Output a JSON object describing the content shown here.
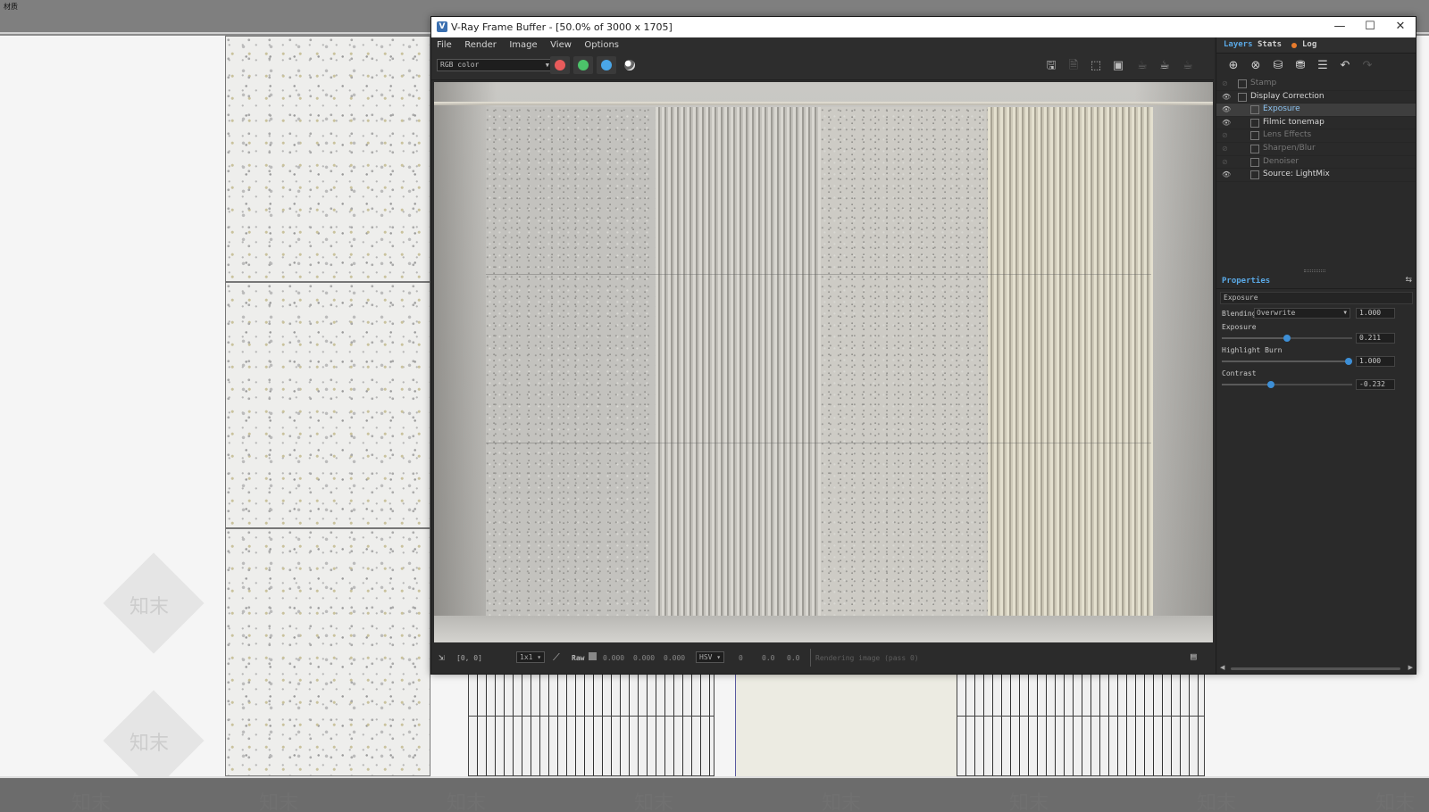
{
  "workspace": {
    "corner_text": "材质",
    "watermark": "知末"
  },
  "window": {
    "title": "V-Ray Frame Buffer - [50.0% of 3000 x 1705]",
    "minimize": "—",
    "maximize": "☐",
    "close": "✕"
  },
  "menu": {
    "file": "File",
    "render": "Render",
    "image": "Image",
    "view": "View",
    "options": "Options"
  },
  "toolbar": {
    "channel": "RGB color",
    "red_color": "#e85b5b",
    "green_color": "#4cc36a",
    "blue_color": "#4aa6e8"
  },
  "status": {
    "coords": "[0, 0]",
    "zoom": "1x1",
    "raw_label": "Raw",
    "r": "0.000",
    "g": "0.000",
    "b": "0.000",
    "color_mode": "HSV",
    "h": "0",
    "s": "0.0",
    "v": "0.0",
    "message": "Rendering image (pass 0)"
  },
  "panel": {
    "tabs": {
      "layers": "Layers",
      "stats": "Stats",
      "log": "Log"
    },
    "layers": [
      {
        "name": "Stamp",
        "visible": false,
        "indent": 0,
        "enabled": false
      },
      {
        "name": "Display Correction",
        "visible": true,
        "indent": 0,
        "enabled": true
      },
      {
        "name": "Exposure",
        "visible": true,
        "indent": 1,
        "enabled": true,
        "selected": true
      },
      {
        "name": "Filmic tonemap",
        "visible": true,
        "indent": 1,
        "enabled": true
      },
      {
        "name": "Lens Effects",
        "visible": false,
        "indent": 1,
        "enabled": false
      },
      {
        "name": "Sharpen/Blur",
        "visible": false,
        "indent": 1,
        "enabled": false
      },
      {
        "name": "Denoiser",
        "visible": false,
        "indent": 1,
        "enabled": false
      },
      {
        "name": "Source: LightMix",
        "visible": true,
        "indent": 1,
        "enabled": true
      }
    ],
    "properties": {
      "header": "Properties",
      "layer_name": "Exposure",
      "blending_label": "Blending",
      "blending_mode": "Overwrite",
      "blending_value": "1.000",
      "exposure_label": "Exposure",
      "exposure_value": "0.211",
      "exposure_pos": 0.5,
      "highlight_label": "Highlight Burn",
      "highlight_value": "1.000",
      "highlight_pos": 0.97,
      "contrast_label": "Contrast",
      "contrast_value": "-0.232",
      "contrast_pos": 0.38
    }
  }
}
